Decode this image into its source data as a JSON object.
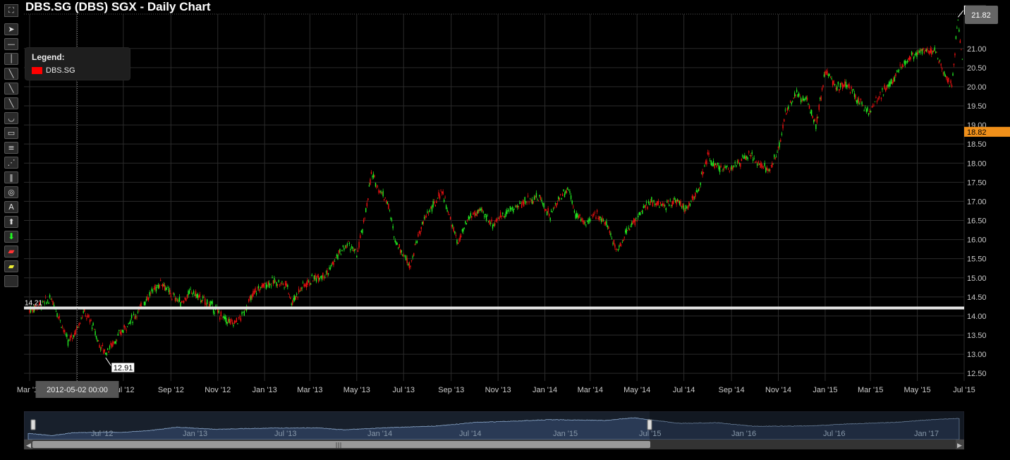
{
  "title": "DBS.SG (DBS) SGX - Daily Chart",
  "legend": {
    "title": "Legend:",
    "series": "DBS.SG"
  },
  "toolbar": {
    "icons": [
      "fullscreen-icon",
      "pointer-icon",
      "horizontal-line-icon",
      "vertical-line-icon",
      "trend-line-icon",
      "ray-icon",
      "parallel-channel-icon",
      "segment-icon",
      "arc-icon",
      "rectangle-icon",
      "fibonacci-retracement-icon",
      "fan-icon",
      "fibonacci-time-icon",
      "circle-icon",
      "text-icon",
      "up-arrow-icon",
      "down-arrow-icon",
      "highlighter-icon",
      "eraser-icon"
    ],
    "text_tool_glyph": "A"
  },
  "colors": {
    "up": "#22ee22",
    "down": "#ee1111",
    "grid": "#2b2b2b",
    "last_price": "#f0901a",
    "hline": "#e6e6e6"
  },
  "price_axis": {
    "last_price": "18.82",
    "peak_tag": "21.82",
    "max_tag_short": "21"
  },
  "hline": {
    "value": 14.21,
    "label": "14.21"
  },
  "crosshair": {
    "date_label": "2012-05-02 00:00",
    "min_label": "12.91"
  },
  "navigator": {
    "labels": [
      "Jul '12",
      "Jan '13",
      "Jul '13",
      "Jan '14",
      "Jul '14",
      "Jan '15",
      "Jul '15",
      "Jan '16",
      "Jul '16",
      "Jan '17"
    ],
    "scroll_grip": "|||"
  },
  "chart_data": {
    "type": "candlestick",
    "title": "DBS.SG (DBS) SGX - Daily Chart",
    "series": [
      {
        "name": "DBS.SG"
      }
    ],
    "x_ticks": [
      "Mar '12",
      "May '12",
      "Jul '12",
      "Sep '12",
      "Nov '12",
      "Jan '13",
      "Mar '13",
      "May '13",
      "Jul '13",
      "Sep '13",
      "Nov '13",
      "Jan '14",
      "Mar '14",
      "May '14",
      "Jul '14",
      "Sep '14",
      "Nov '14",
      "Jan '15",
      "Mar '15",
      "May '15",
      "Jul '15"
    ],
    "y_ticks": [
      12.5,
      13.0,
      13.5,
      14.0,
      14.5,
      15.0,
      15.5,
      16.0,
      16.5,
      17.0,
      17.5,
      18.0,
      18.5,
      19.0,
      19.5,
      20.0,
      20.5,
      21.0
    ],
    "ylim": [
      12.3,
      21.9
    ],
    "x_range": [
      "2012-03-01",
      "2015-07-01"
    ],
    "close_path": [
      [
        "2012-03-01",
        14.15
      ],
      [
        "2012-03-15",
        14.3
      ],
      [
        "2012-03-30",
        14.45
      ],
      [
        "2012-04-10",
        13.9
      ],
      [
        "2012-04-20",
        13.3
      ],
      [
        "2012-04-30",
        13.6
      ],
      [
        "2012-05-10",
        14.1
      ],
      [
        "2012-05-20",
        13.85
      ],
      [
        "2012-05-31",
        13.25
      ],
      [
        "2012-06-08",
        13.05
      ],
      [
        "2012-06-20",
        13.35
      ],
      [
        "2012-07-05",
        13.75
      ],
      [
        "2012-07-20",
        14.1
      ],
      [
        "2012-07-31",
        14.45
      ],
      [
        "2012-08-10",
        14.7
      ],
      [
        "2012-08-20",
        14.9
      ],
      [
        "2012-09-01",
        14.55
      ],
      [
        "2012-09-15",
        14.35
      ],
      [
        "2012-09-28",
        14.65
      ],
      [
        "2012-10-10",
        14.45
      ],
      [
        "2012-10-25",
        14.25
      ],
      [
        "2012-11-08",
        13.95
      ],
      [
        "2012-11-20",
        13.8
      ],
      [
        "2012-12-01",
        13.95
      ],
      [
        "2012-12-10",
        14.3
      ],
      [
        "2012-12-20",
        14.65
      ],
      [
        "2013-01-03",
        14.85
      ],
      [
        "2013-01-15",
        14.9
      ],
      [
        "2013-01-31",
        14.8
      ],
      [
        "2013-02-05",
        14.35
      ],
      [
        "2013-02-20",
        14.8
      ],
      [
        "2013-03-08",
        15.0
      ],
      [
        "2013-03-25",
        15.15
      ],
      [
        "2013-04-05",
        15.55
      ],
      [
        "2013-04-20",
        15.9
      ],
      [
        "2013-05-01",
        15.6
      ],
      [
        "2013-05-10",
        16.4
      ],
      [
        "2013-05-20",
        17.7
      ],
      [
        "2013-05-31",
        17.3
      ],
      [
        "2013-06-10",
        17.0
      ],
      [
        "2013-06-20",
        16.0
      ],
      [
        "2013-07-01",
        15.6
      ],
      [
        "2013-07-10",
        15.35
      ],
      [
        "2013-07-20",
        16.1
      ],
      [
        "2013-08-01",
        16.7
      ],
      [
        "2013-08-10",
        16.9
      ],
      [
        "2013-08-20",
        17.3
      ],
      [
        "2013-08-31",
        16.5
      ],
      [
        "2013-09-10",
        15.9
      ],
      [
        "2013-09-25",
        16.6
      ],
      [
        "2013-10-10",
        16.75
      ],
      [
        "2013-10-25",
        16.4
      ],
      [
        "2013-11-10",
        16.7
      ],
      [
        "2013-11-25",
        16.85
      ],
      [
        "2013-12-10",
        17.05
      ],
      [
        "2013-12-25",
        17.1
      ],
      [
        "2014-01-08",
        16.6
      ],
      [
        "2014-01-20",
        17.1
      ],
      [
        "2014-02-01",
        17.35
      ],
      [
        "2014-02-10",
        16.65
      ],
      [
        "2014-02-25",
        16.4
      ],
      [
        "2014-03-10",
        16.7
      ],
      [
        "2014-03-25",
        16.3
      ],
      [
        "2014-04-05",
        15.7
      ],
      [
        "2014-04-20",
        16.3
      ],
      [
        "2014-05-08",
        16.75
      ],
      [
        "2014-05-20",
        17.0
      ],
      [
        "2014-06-05",
        16.85
      ],
      [
        "2014-06-20",
        17.05
      ],
      [
        "2014-07-05",
        16.8
      ],
      [
        "2014-07-20",
        17.3
      ],
      [
        "2014-08-01",
        18.2
      ],
      [
        "2014-08-10",
        17.9
      ],
      [
        "2014-08-25",
        17.85
      ],
      [
        "2014-09-10",
        18.0
      ],
      [
        "2014-09-25",
        18.2
      ],
      [
        "2014-10-10",
        17.95
      ],
      [
        "2014-10-20",
        17.8
      ],
      [
        "2014-11-01",
        18.3
      ],
      [
        "2014-11-10",
        19.3
      ],
      [
        "2014-11-25",
        19.8
      ],
      [
        "2014-12-10",
        19.6
      ],
      [
        "2014-12-20",
        19.0
      ],
      [
        "2015-01-01",
        20.4
      ],
      [
        "2015-01-15",
        20.0
      ],
      [
        "2015-01-31",
        20.05
      ],
      [
        "2015-02-15",
        19.6
      ],
      [
        "2015-02-28",
        19.35
      ],
      [
        "2015-03-15",
        19.8
      ],
      [
        "2015-03-31",
        20.2
      ],
      [
        "2015-04-10",
        20.55
      ],
      [
        "2015-04-25",
        20.85
      ],
      [
        "2015-05-10",
        20.95
      ],
      [
        "2015-05-25",
        20.95
      ],
      [
        "2015-06-05",
        20.3
      ],
      [
        "2015-06-15",
        20.0
      ],
      [
        "2015-06-23",
        21.82
      ],
      [
        "2015-06-30",
        20.3
      ]
    ],
    "annotations": {
      "max": 21.82,
      "min": 12.91,
      "horizontal_line": 14.21,
      "last_price": 18.82
    },
    "legend_position": "top-left",
    "grid": true
  }
}
